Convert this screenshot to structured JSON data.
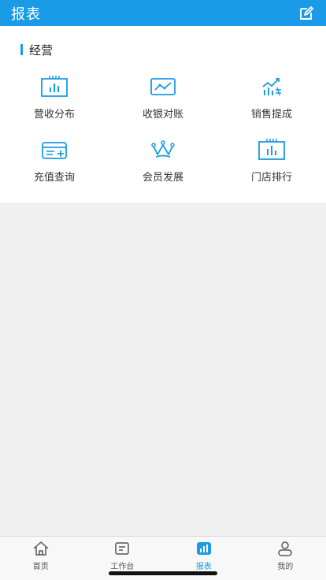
{
  "header": {
    "title": "报表",
    "edit_icon": "edit-icon"
  },
  "section": {
    "title": "经营",
    "items": [
      {
        "label": "营收分布",
        "icon": "bar-chart-icon"
      },
      {
        "label": "收银对账",
        "icon": "trend-line-icon"
      },
      {
        "label": "销售提成",
        "icon": "growth-chart-icon"
      },
      {
        "label": "充值查询",
        "icon": "card-add-icon"
      },
      {
        "label": "会员发展",
        "icon": "crown-icon"
      },
      {
        "label": "门店排行",
        "icon": "ranking-chart-icon"
      }
    ]
  },
  "tabbar": {
    "tabs": [
      {
        "label": "首页",
        "icon": "home-icon",
        "active": false
      },
      {
        "label": "工作台",
        "icon": "workbench-icon",
        "active": false
      },
      {
        "label": "报表",
        "icon": "report-icon",
        "active": true
      },
      {
        "label": "我的",
        "icon": "user-icon",
        "active": false
      }
    ]
  },
  "colors": {
    "brand": "#1a9be8",
    "background": "#f0f0f0",
    "text": "#333333"
  }
}
